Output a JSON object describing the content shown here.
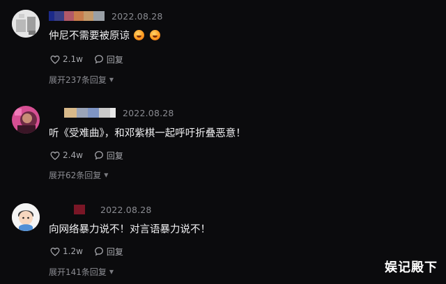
{
  "comments": [
    {
      "time": "2022.08.28",
      "text": "仲尼不需要被原谅",
      "emojis": [
        "smile-emoji",
        "smile-emoji"
      ],
      "likes": "2.1w",
      "reply_label": "回复",
      "expand_label": "展开237条回复"
    },
    {
      "time": "2022.08.28",
      "text": "听《受难曲》，和邓紫棋一起呼吁折叠恶意！",
      "likes": "2.4w",
      "reply_label": "回复",
      "expand_label": "展开62条回复"
    },
    {
      "time": "2022.08.28",
      "text": "向网络暴力说不！对言语暴力说不！",
      "likes": "1.2w",
      "reply_label": "回复",
      "expand_label": "展开141条回复"
    }
  ],
  "watermark": "娱记殿下",
  "icons": {
    "like": "heart-icon",
    "reply": "comment-bubble-icon",
    "expand": "chevron-down-icon"
  },
  "colors": {
    "background": "#0b0b0d",
    "text": "#f1f1f3",
    "muted": "#8b8c92"
  }
}
